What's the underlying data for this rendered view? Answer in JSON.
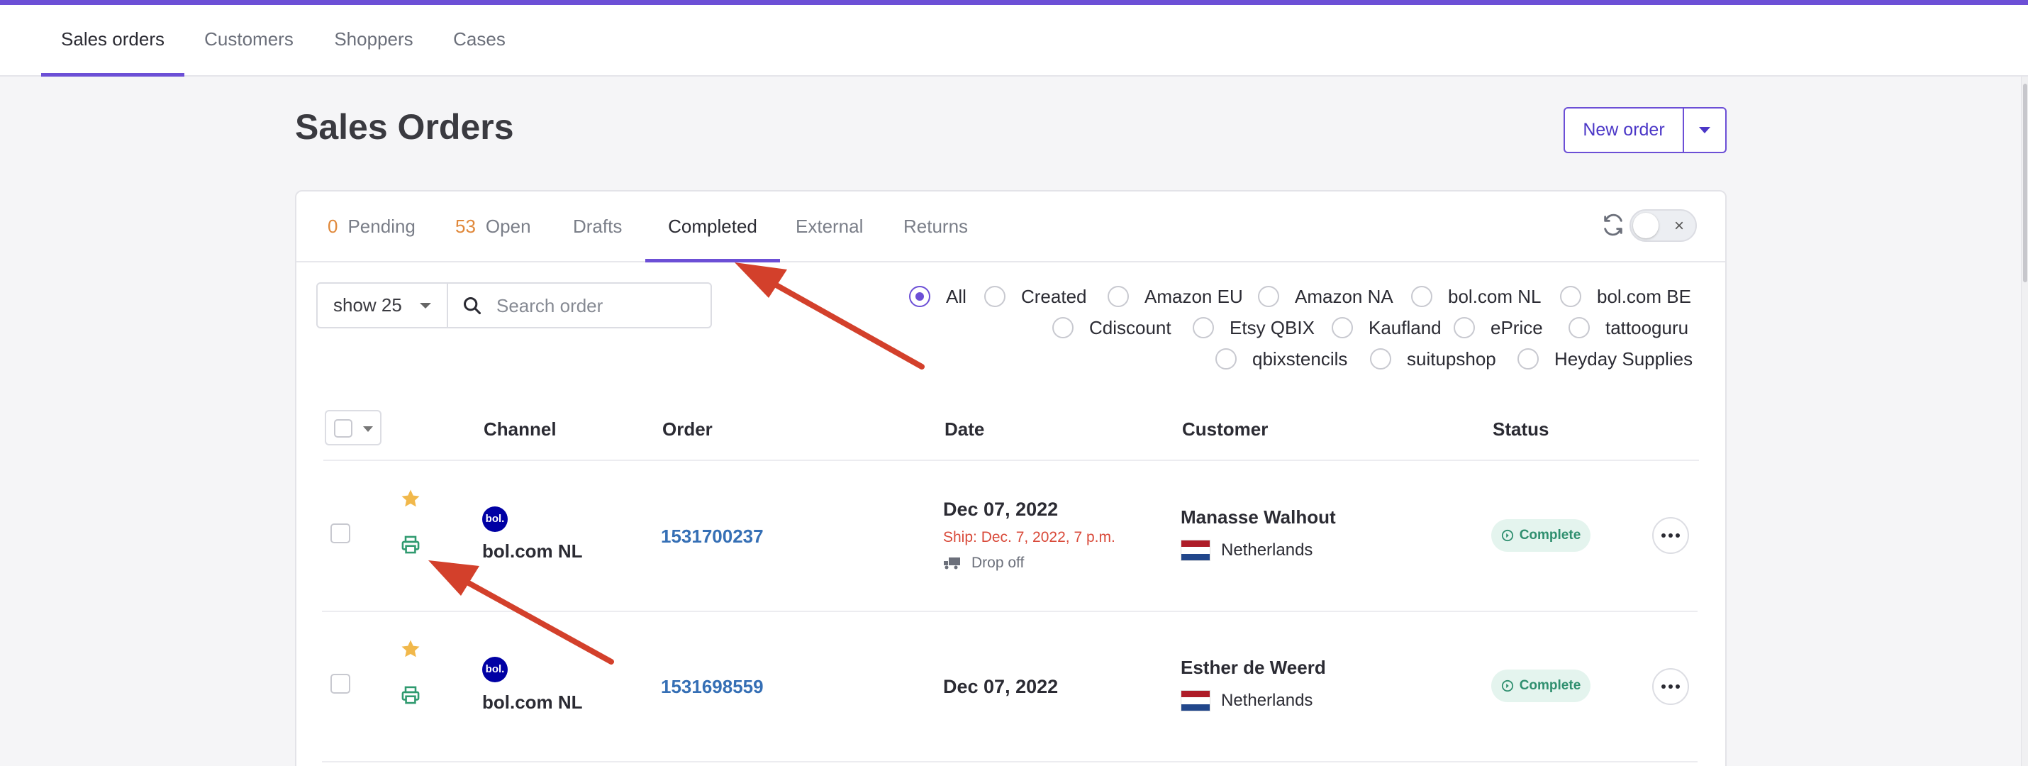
{
  "nav": {
    "tabs": [
      {
        "label": "Sales orders",
        "active": true
      },
      {
        "label": "Customers",
        "active": false
      },
      {
        "label": "Shoppers",
        "active": false
      },
      {
        "label": "Cases",
        "active": false
      }
    ]
  },
  "page": {
    "title": "Sales Orders",
    "new_order_label": "New order"
  },
  "status_tabs": [
    {
      "count": "0",
      "label": "Pending"
    },
    {
      "count": "53",
      "label": "Open"
    },
    {
      "count": "",
      "label": "Drafts"
    },
    {
      "count": "",
      "label": "Completed",
      "active": true
    },
    {
      "count": "",
      "label": "External"
    },
    {
      "count": "",
      "label": "Returns"
    }
  ],
  "toolbar": {
    "show_label": "show 25",
    "search_placeholder": "Search order",
    "toggle_label": "×"
  },
  "filters": {
    "selected": "All",
    "options": [
      "All",
      "Created",
      "Amazon EU",
      "Amazon NA",
      "bol.com NL",
      "bol.com BE",
      "Cdiscount",
      "Etsy QBIX",
      "Kaufland",
      "ePrice",
      "tattooguru",
      "qbixstencils",
      "suitupshop",
      "Heyday Supplies"
    ]
  },
  "table": {
    "columns": [
      "Channel",
      "Order",
      "Date",
      "Customer",
      "Status"
    ],
    "rows": [
      {
        "channel": "bol.com NL",
        "channel_logo": "bol.",
        "order": "1531700237",
        "date": "Dec 07, 2022",
        "ship": "Ship: Dec. 7, 2022, 7 p.m.",
        "shipping_method": "Drop off",
        "customer": "Manasse Walhout",
        "country": "Netherlands",
        "status": "Complete"
      },
      {
        "channel": "bol.com NL",
        "channel_logo": "bol.",
        "order": "1531698559",
        "date": "Dec 07, 2022",
        "customer": "Esther de Weerd",
        "country": "Netherlands",
        "status": "Complete"
      }
    ]
  },
  "colors": {
    "accent": "#6c4fd6",
    "count": "#e0883a",
    "link": "#356fb5",
    "ship": "#d94a3a",
    "status_complete": "#2f8f6f",
    "star": "#f1b84b",
    "printer": "#2f9a6f",
    "annotation_arrow": "#d3402b"
  },
  "icons": [
    "refresh-icon",
    "search-icon",
    "star-icon",
    "printer-icon",
    "truck-icon",
    "check-circle-icon",
    "ellipsis-icon",
    "caret-down-icon",
    "netherlands-flag-icon"
  ]
}
